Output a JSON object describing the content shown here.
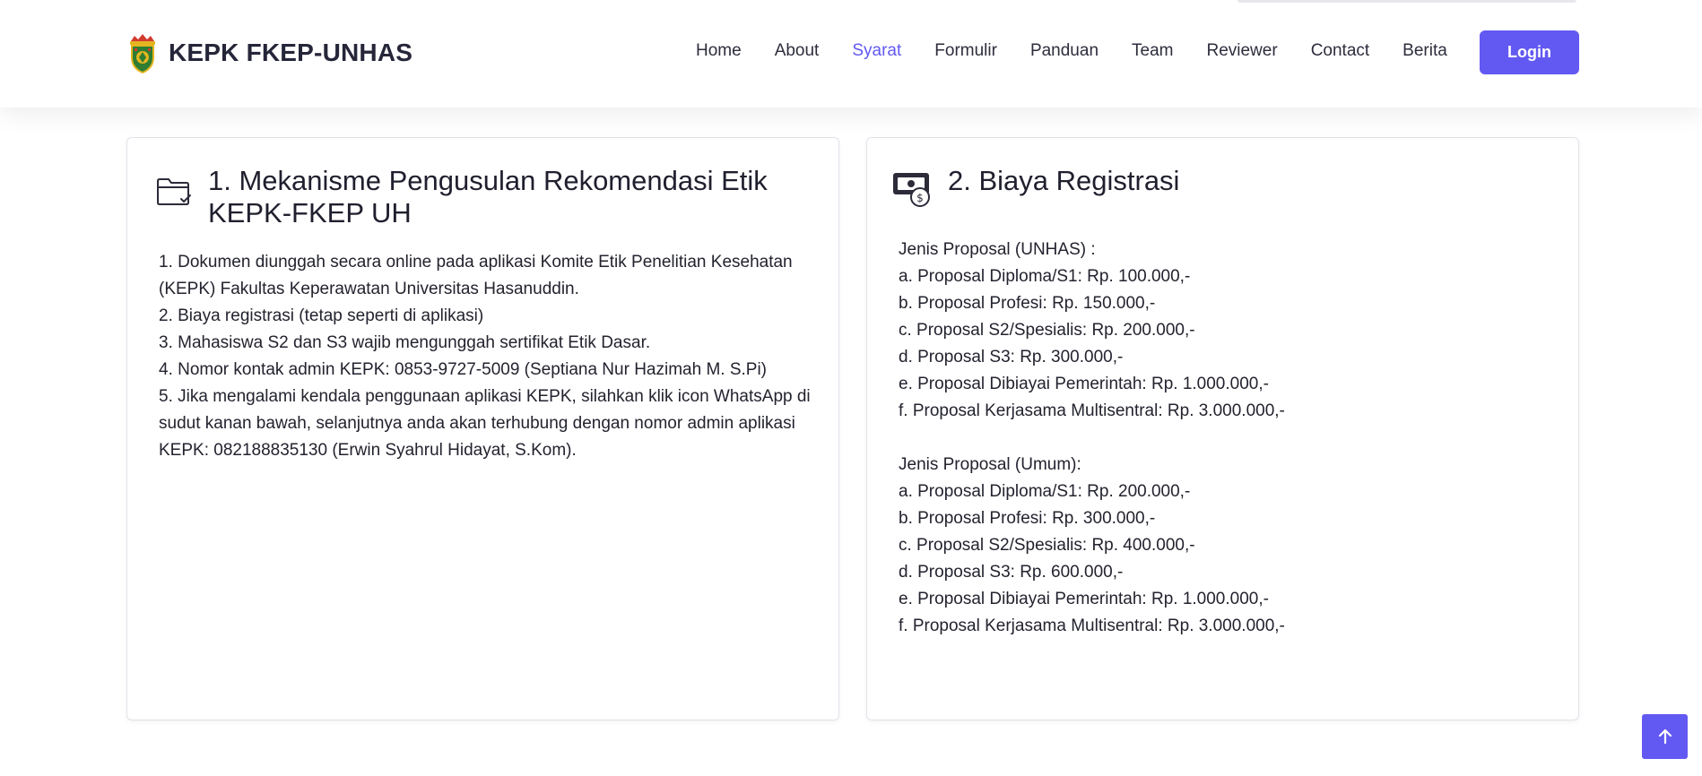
{
  "header": {
    "brand_title": "KEPK FKEP-UNHAS",
    "logo_icon": "unhas-crest-icon",
    "nav": [
      {
        "label": "Home",
        "active": false
      },
      {
        "label": "About",
        "active": false
      },
      {
        "label": "Syarat",
        "active": true
      },
      {
        "label": "Formulir",
        "active": false
      },
      {
        "label": "Panduan",
        "active": false
      },
      {
        "label": "Team",
        "active": false
      },
      {
        "label": "Reviewer",
        "active": false
      },
      {
        "label": "Contact",
        "active": false
      },
      {
        "label": "Berita",
        "active": false
      }
    ],
    "login_label": "Login"
  },
  "cards": {
    "mekanisme": {
      "icon": "folder-check-icon",
      "title": "1. Mekanisme Pengusulan Rekomendasi Etik KEPK-FKEP UH",
      "items": [
        "1. Dokumen diunggah secara online pada aplikasi Komite Etik Penelitian Kesehatan (KEPK) Fakultas Keperawatan Universitas Hasanuddin.",
        "2. Biaya registrasi (tetap seperti di aplikasi)",
        "3. Mahasiswa S2 dan S3 wajib mengunggah sertifikat Etik Dasar.",
        "4. Nomor kontak admin KEPK: 0853-9727-5009 (Septiana Nur Hazimah M. S.Pi)",
        "5. Jika mengalami kendala penggunaan aplikasi KEPK, silahkan klik icon WhatsApp di sudut kanan bawah, selanjutnya anda akan terhubung dengan nomor admin aplikasi KEPK: 082188835130 (Erwin Syahrul Hidayat, S.Kom)."
      ]
    },
    "biaya": {
      "icon": "money-cycle-icon",
      "title": "2. Biaya Registrasi",
      "unhas": {
        "heading": "Jenis Proposal (UNHAS) :",
        "items": [
          "a. Proposal Diploma/S1: Rp. 100.000,-",
          "b. Proposal Profesi: Rp. 150.000,-",
          "c. Proposal S2/Spesialis: Rp. 200.000,-",
          "d. Proposal S3: Rp. 300.000,-",
          "e. Proposal Dibiayai Pemerintah: Rp. 1.000.000,-",
          "f. Proposal Kerjasama Multisentral: Rp. 3.000.000,-"
        ]
      },
      "umum": {
        "heading": "Jenis Proposal (Umum):",
        "items": [
          "a. Proposal Diploma/S1: Rp. 200.000,-",
          "b. Proposal Profesi: Rp. 300.000,-",
          "c. Proposal S2/Spesialis: Rp. 400.000,-",
          "d. Proposal S3: Rp. 600.000,-",
          "e. Proposal Dibiayai Pemerintah: Rp. 1.000.000,-",
          "f. Proposal Kerjasama Multisentral: Rp. 3.000.000,-"
        ]
      }
    }
  },
  "scroll_top_icon": "arrow-up-icon",
  "colors": {
    "accent": "#6259f2",
    "text": "#1f1f2e",
    "card_border": "#e1e2ea"
  }
}
